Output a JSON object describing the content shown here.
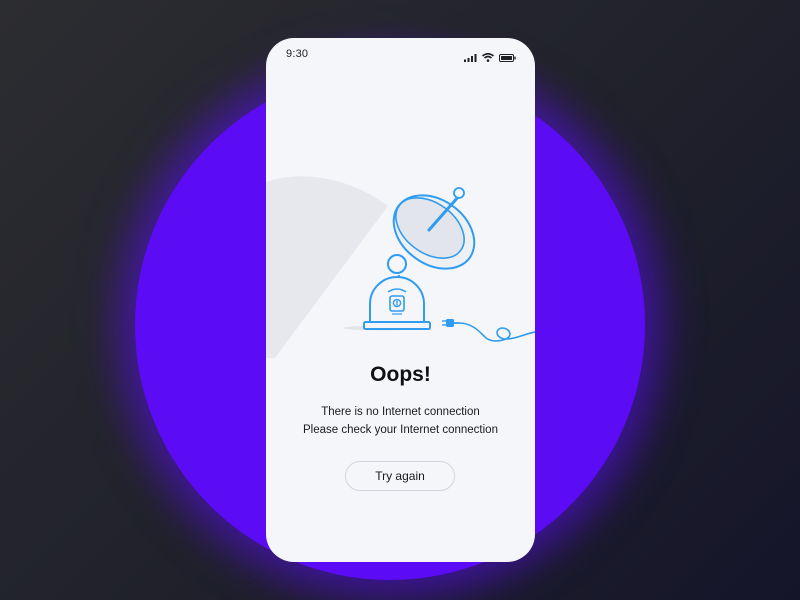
{
  "status_bar": {
    "time": "9:30",
    "icons": [
      "signal-icon",
      "wifi-icon",
      "battery-icon"
    ]
  },
  "error": {
    "title": "Oops!",
    "message_line1": "There is no Internet connection",
    "message_line2": "Please check your Internet connection"
  },
  "actions": {
    "retry_label": "Try again"
  },
  "illustration": {
    "icon": "satellite-dish-unplugged-icon"
  },
  "colors": {
    "accent_purple": "#5b0cf4",
    "illustration_blue": "#2f9cf0",
    "phone_background": "#f5f6f9",
    "page_background": "#22232b"
  }
}
